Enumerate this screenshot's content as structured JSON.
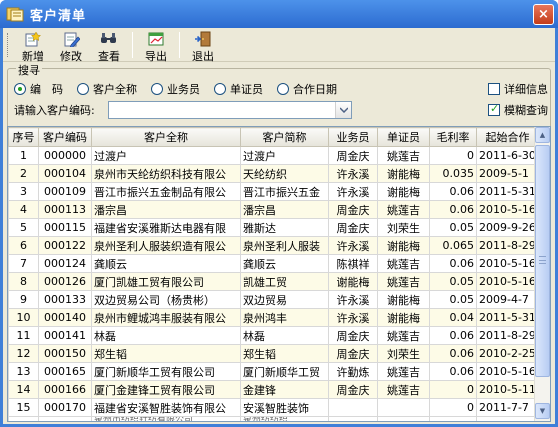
{
  "window": {
    "title": "客户清单",
    "close_label": "×"
  },
  "toolbar": {
    "buttons": [
      {
        "label": "新增",
        "icon": "add-icon"
      },
      {
        "label": "修改",
        "icon": "edit-icon"
      },
      {
        "label": "查看",
        "icon": "view-icon"
      },
      {
        "label": "导出",
        "icon": "export-icon"
      },
      {
        "label": "退出",
        "icon": "exit-icon"
      }
    ]
  },
  "search": {
    "legend": "搜寻",
    "radios": [
      "编　码",
      "客户全称",
      "业务员",
      "单证员",
      "合作日期"
    ],
    "selected_radio": "编　码",
    "detail_label": "详细信息",
    "detail_checked": false,
    "fuzzy_label": "模糊查询",
    "fuzzy_checked": true,
    "code_label": "请输入客户编码:",
    "code_value": ""
  },
  "grid": {
    "columns": [
      "序号",
      "客户编码",
      "客户全称",
      "客户简称",
      "业务员",
      "单证员",
      "毛利率",
      "起始合作"
    ],
    "rows": [
      [
        "1",
        "000000",
        "过渡户",
        "过渡户",
        "周金庆",
        "姚莲吉",
        "0",
        "2011-6-30"
      ],
      [
        "2",
        "000104",
        "泉州市天纶纺织科技有限公",
        "天纶纺织",
        "许永溪",
        "谢能梅",
        "0.035",
        "2009-5-1"
      ],
      [
        "3",
        "000109",
        "晋江市振兴五金制品有限公",
        "晋江市振兴五金",
        "许永溪",
        "谢能梅",
        "0.06",
        "2011-5-31"
      ],
      [
        "4",
        "000113",
        "潘宗昌",
        "潘宗昌",
        "周金庆",
        "姚莲吉",
        "0.06",
        "2010-5-16"
      ],
      [
        "5",
        "000115",
        "福建省安溪雅斯达电器有限",
        "雅斯达",
        "周金庆",
        "刘荣生",
        "0.05",
        "2009-9-26"
      ],
      [
        "6",
        "000122",
        "泉州圣利人服装织造有限公",
        "泉州圣利人服装",
        "许永溪",
        "谢能梅",
        "0.065",
        "2011-8-29"
      ],
      [
        "7",
        "000124",
        "龚顺云",
        "龚顺云",
        "陈祺祥",
        "姚莲吉",
        "0.06",
        "2010-5-16"
      ],
      [
        "8",
        "000126",
        "厦门凯雄工贸有限公司",
        "凯雄工贸",
        "谢能梅",
        "姚莲吉",
        "0.05",
        "2010-5-16"
      ],
      [
        "9",
        "000133",
        "双边贸易公司（杨贵彬）",
        "双边贸易",
        "许永溪",
        "谢能梅",
        "0.05",
        "2009-4-7"
      ],
      [
        "10",
        "000140",
        "泉州市鲤城鸿丰服装有限公",
        "泉州鸿丰",
        "许永溪",
        "谢能梅",
        "0.04",
        "2011-5-31"
      ],
      [
        "11",
        "000141",
        "林磊",
        "林磊",
        "周金庆",
        "姚莲吉",
        "0.06",
        "2011-8-29"
      ],
      [
        "12",
        "000150",
        "郑生韬",
        "郑生韬",
        "周金庆",
        "刘荣生",
        "0.06",
        "2010-2-25"
      ],
      [
        "13",
        "000165",
        "厦门新顺华工贸有限公司",
        "厦门新顺华工贸",
        "许勤炼",
        "姚莲吉",
        "0.06",
        "2010-5-16"
      ],
      [
        "14",
        "000166",
        "厦门金建锋工贸有限公司",
        "金建锋",
        "周金庆",
        "姚莲吉",
        "0",
        "2010-5-11"
      ],
      [
        "15",
        "000170",
        "福建省安溪智胜装饰有限公",
        "安溪智胜装饰",
        "",
        "",
        "0",
        "2011-7-7"
      ]
    ],
    "partial_row": [
      "",
      "",
      "泉州市纺织针纺有限公司",
      "泉州纺纺织",
      "",
      "",
      "",
      ""
    ]
  },
  "colors": {
    "title_bar": "#2c6bd0",
    "client_bg": "#ece9d8",
    "row_alt": "#fdfbe7"
  }
}
